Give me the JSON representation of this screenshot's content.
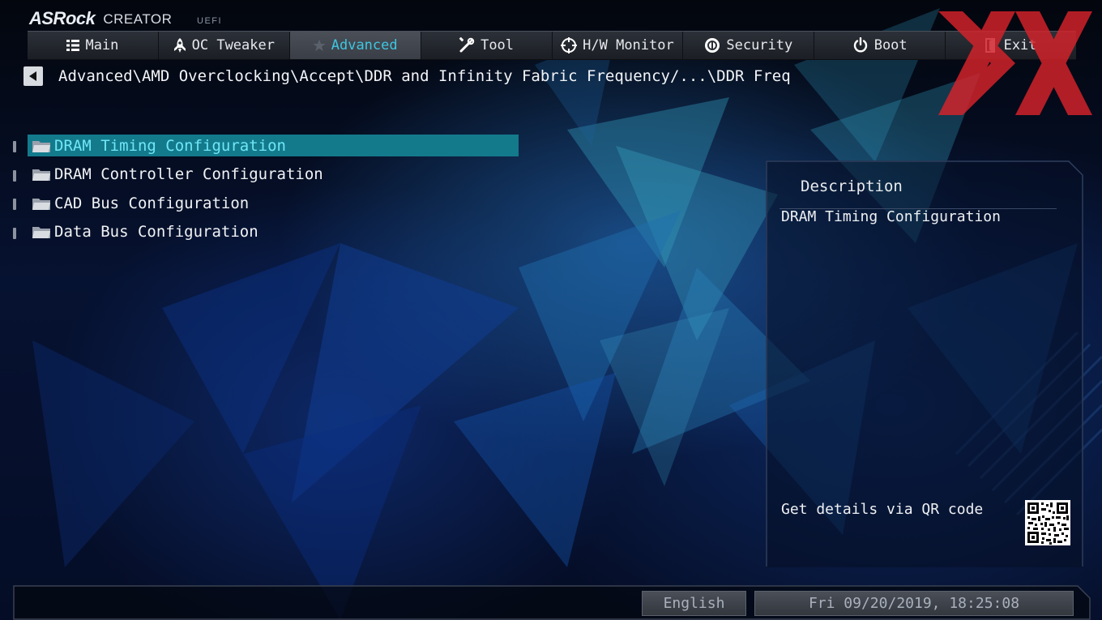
{
  "logo": {
    "brand": "ASRock",
    "product": "CREATOR",
    "firmware": "UEFI"
  },
  "nav": {
    "tabs": [
      {
        "label": "Main",
        "icon": "list-icon",
        "active": false
      },
      {
        "label": "OC Tweaker",
        "icon": "rocket-icon",
        "active": false
      },
      {
        "label": "Advanced",
        "icon": "star-icon",
        "active": true
      },
      {
        "label": "Tool",
        "icon": "tools-icon",
        "active": false
      },
      {
        "label": "H/W Monitor",
        "icon": "crosshair-icon",
        "active": false
      },
      {
        "label": "Security",
        "icon": "shield-icon",
        "active": false
      },
      {
        "label": "Boot",
        "icon": "power-icon",
        "active": false
      },
      {
        "label": "Exit",
        "icon": "exit-door-icon",
        "active": false
      }
    ]
  },
  "breadcrumb": {
    "back_icon": "back-arrow-icon",
    "path": "Advanced\\AMD Overclocking\\Accept\\DDR and Infinity Fabric Frequency/...\\DDR Freq"
  },
  "menu": {
    "items": [
      {
        "label": "DRAM Timing Configuration",
        "icon": "folder-icon",
        "selected": true
      },
      {
        "label": "DRAM Controller Configuration",
        "icon": "folder-icon",
        "selected": false
      },
      {
        "label": "CAD Bus Configuration",
        "icon": "folder-icon",
        "selected": false
      },
      {
        "label": "Data Bus Configuration",
        "icon": "folder-icon",
        "selected": false
      }
    ]
  },
  "description": {
    "title": "Description",
    "text": "DRAM Timing Configuration",
    "qr_label": "Get details via QR code",
    "qr_icon": "qr-code-icon"
  },
  "footer": {
    "language": "English",
    "datetime": "Fri 09/20/2019, 18:25:08"
  },
  "colors": {
    "accent": "#3ec6e0",
    "selection": "#137a8c",
    "watermark": "#d8232a"
  }
}
